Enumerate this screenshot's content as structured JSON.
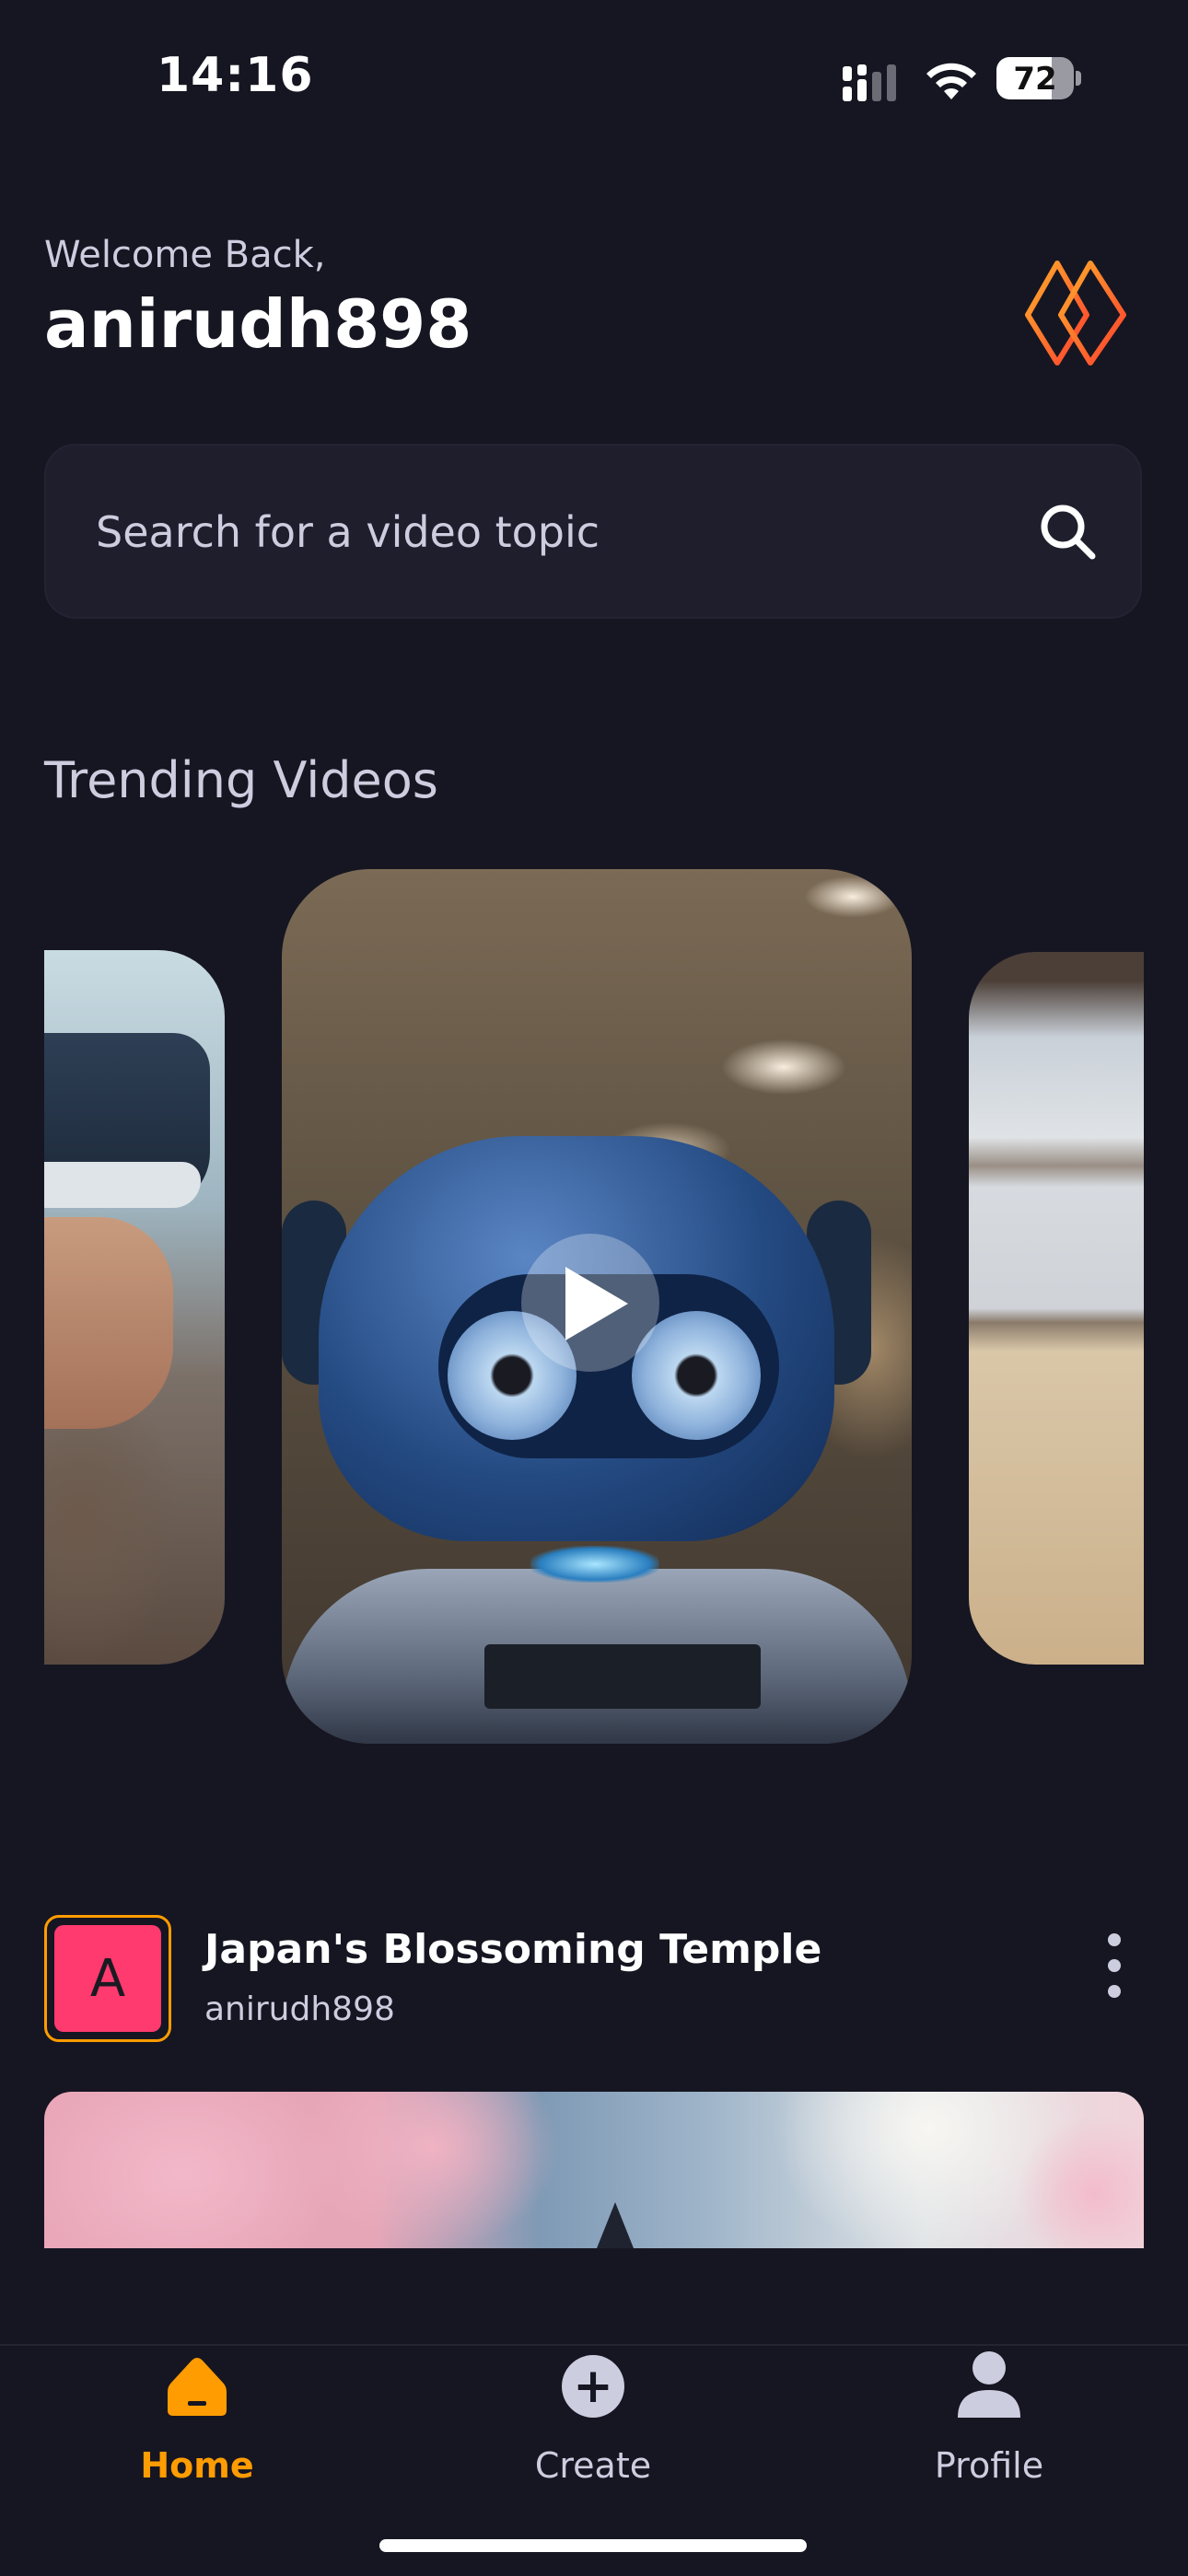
{
  "status_bar": {
    "time": "14:16",
    "battery": "72",
    "battery_level": 0.72
  },
  "header": {
    "welcome": "Welcome Back,",
    "username": "anirudh898",
    "logo": "flame-logo-icon"
  },
  "search": {
    "placeholder": "Search for a video topic",
    "icon": "search-icon"
  },
  "trending": {
    "title": "Trending Videos"
  },
  "post": {
    "avatar_letter": "A",
    "title": "Japan's Blossoming Temple",
    "author": "anirudh898"
  },
  "nav": {
    "items": [
      {
        "label": "Home",
        "icon": "home-icon",
        "active": true
      },
      {
        "label": "Create",
        "icon": "plus-circle-icon",
        "active": false
      },
      {
        "label": "Profile",
        "icon": "user-icon",
        "active": false
      }
    ]
  },
  "colors": {
    "background": "#161622",
    "accent": "#ff9c01",
    "avatar_bg": "#ff3a6e",
    "muted_text": "#cdcde0"
  }
}
